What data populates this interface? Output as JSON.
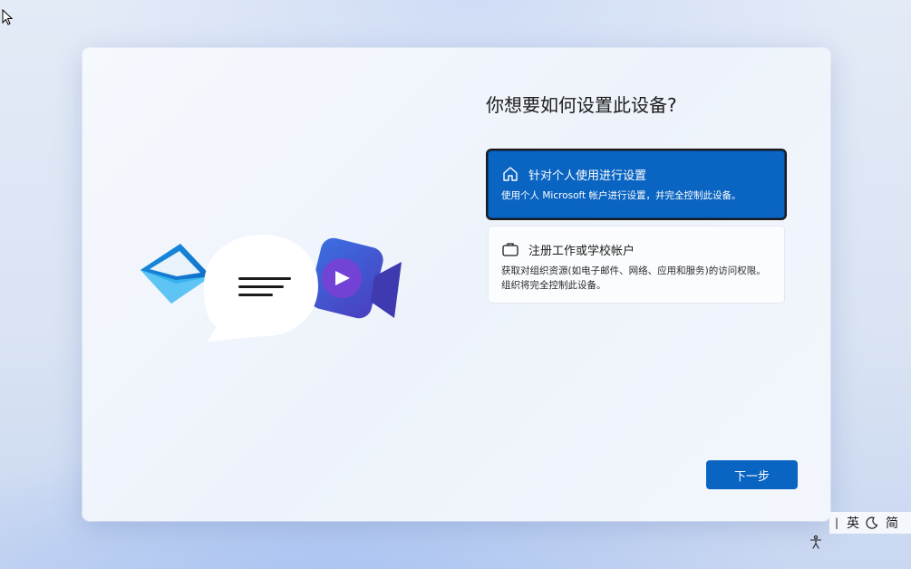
{
  "page": {
    "title": "你想要如何设置此设备?"
  },
  "options": [
    {
      "icon": "home-icon",
      "title": "针对个人使用进行设置",
      "description": "使用个人 Microsoft 帐户进行设置，并完全控制此设备。",
      "selected": true
    },
    {
      "icon": "briefcase-icon",
      "title": "注册工作或学校帐户",
      "description": "获取对组织资源(如电子邮件、网络、应用和服务)的访问权限。组织将完全控制此设备。",
      "selected": false
    }
  ],
  "next_button": {
    "label": "下一步"
  },
  "ime": {
    "mode": "英",
    "script": "简"
  },
  "colors": {
    "accent": "#0a64c2",
    "card_bg": "#f5f8fd",
    "text": "#1c1c1c"
  }
}
